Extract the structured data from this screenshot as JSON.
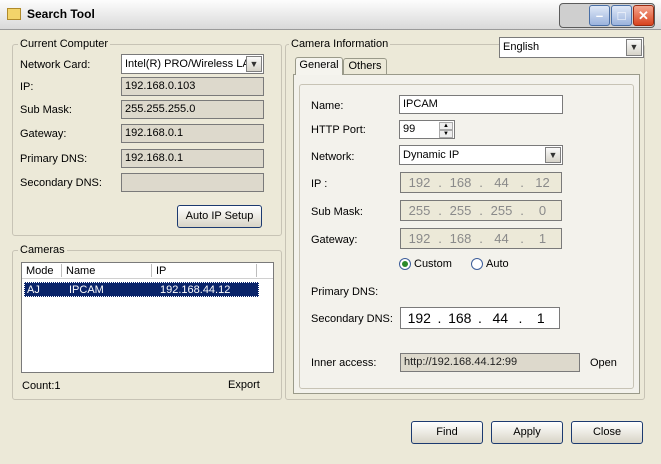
{
  "window": {
    "title": "Search Tool"
  },
  "language": {
    "selected": "English"
  },
  "current_computer": {
    "legend": "Current Computer",
    "network_card_label": "Network Card:",
    "network_card_value": "Intel(R) PRO/Wireless LA",
    "ip_label": "IP:",
    "ip_value": "192.168.0.103",
    "submask_label": "Sub Mask:",
    "submask_value": "255.255.255.0",
    "gateway_label": "Gateway:",
    "gateway_value": "192.168.0.1",
    "primary_dns_label": "Primary DNS:",
    "primary_dns_value": "192.168.0.1",
    "secondary_dns_label": "Secondary DNS:",
    "secondary_dns_value": "",
    "auto_ip_button": "Auto IP Setup"
  },
  "cameras": {
    "legend": "Cameras",
    "columns": [
      "Mode",
      "Name",
      "IP"
    ],
    "rows": [
      {
        "mode": "AJ",
        "name": "IPCAM",
        "ip": "192.168.44.12"
      }
    ],
    "count_label": "Count:1",
    "export_label": "Export"
  },
  "camera_info": {
    "legend": "Camera Information",
    "tabs": [
      "General",
      "Others"
    ],
    "name_label": "Name:",
    "name_value": "IPCAM",
    "http_port_label": "HTTP Port:",
    "http_port_value": "99",
    "network_label": "Network:",
    "network_value": "Dynamic IP",
    "ip_label": "IP  :",
    "ip_octets": [
      "192",
      "168",
      "44",
      "12"
    ],
    "submask_label": "Sub Mask:",
    "submask_octets": [
      "255",
      "255",
      "255",
      "0"
    ],
    "gateway_label": "Gateway:",
    "gateway_octets": [
      "192",
      "168",
      "44",
      "1"
    ],
    "radio_custom": "Custom",
    "radio_auto": "Auto",
    "primary_dns_label": "Primary DNS:",
    "secondary_dns_label": "Secondary DNS:",
    "secondary_dns_octets": [
      "192",
      "168",
      "44",
      "1"
    ],
    "inner_access_label": "Inner access:",
    "inner_access_value": "http://192.168.44.12:99",
    "open_label": "Open"
  },
  "footer": {
    "find": "Find",
    "apply": "Apply",
    "close": "Close"
  },
  "colors": {
    "selection": "#0a246a",
    "window_bg": "#ece9d8"
  }
}
